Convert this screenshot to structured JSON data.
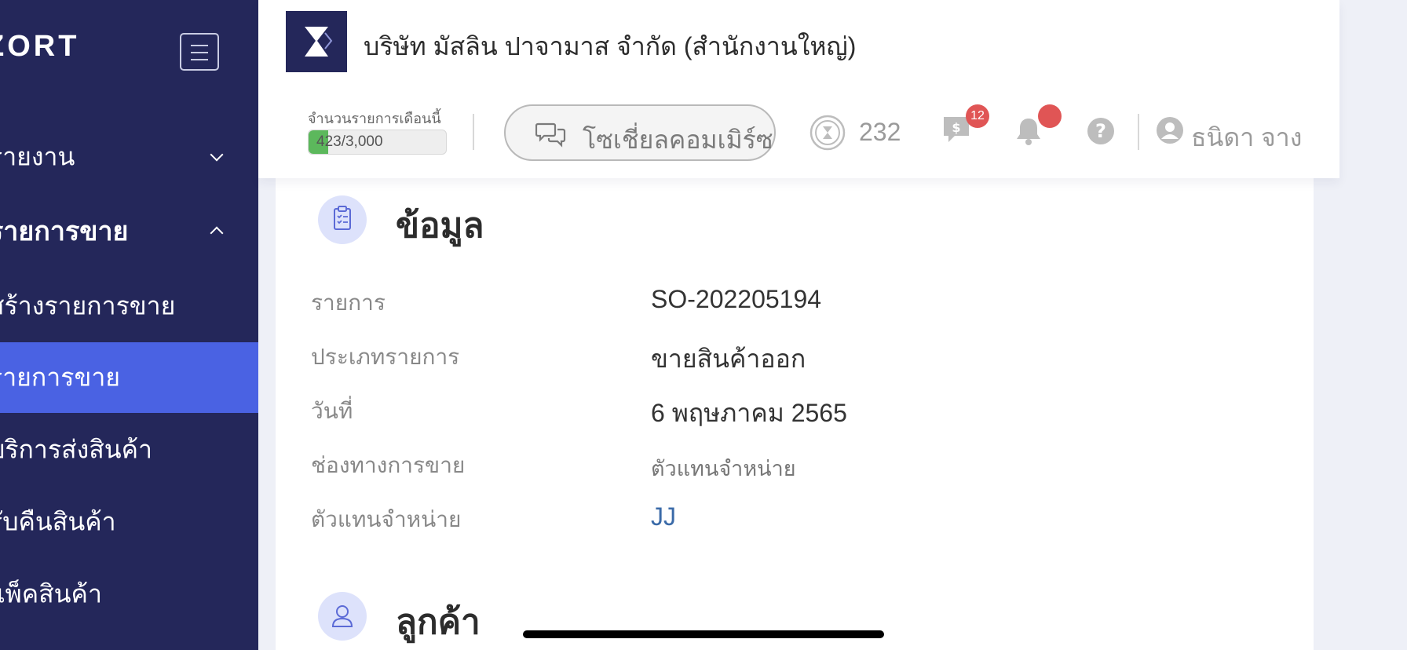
{
  "sidebar": {
    "brand": "ZORT",
    "items": [
      {
        "label": "รายงาน"
      },
      {
        "label": "รายการขาย"
      },
      {
        "label": "สร้างรายการขาย"
      },
      {
        "label": "รายการขาย"
      },
      {
        "label": "บริการส่งสินค้า"
      },
      {
        "label": "รับคืนสินค้า"
      },
      {
        "label": "แพ็คสินค้า"
      }
    ]
  },
  "header": {
    "company": "บริษัท มัสลิน ปาจามาส จำกัด (สำนักงานใหญ่)",
    "quota_label": "จำนวนรายการเดือนนี้",
    "quota_text": "423/3,000",
    "quota_used": 423,
    "quota_total": 3000,
    "social_button": "โซเชี่ยลคอมเมิร์ซ",
    "coins": "232",
    "message_badge": "12",
    "user_name": "ธนิดา จาง"
  },
  "info": {
    "title": "ข้อมูล",
    "rows": [
      {
        "label": "รายการ",
        "value": "SO-202205194"
      },
      {
        "label": "ประเภทรายการ",
        "value": "ขายสินค้าออก"
      },
      {
        "label": "วันที่",
        "value": "6 พฤษภาคม 2565"
      },
      {
        "label": "ช่องทางการขาย",
        "value": "ตัวแทนจำหน่าย"
      },
      {
        "label": "ตัวแทนจำหน่าย",
        "value": "JJ"
      }
    ]
  },
  "customer": {
    "title": "ลูกค้า"
  },
  "colors": {
    "sidebar_bg": "#24275a",
    "active_item": "#4a62e3",
    "badge_red": "#e05555",
    "quota_green": "#5cb85c",
    "link_blue": "#3a6aa8"
  }
}
